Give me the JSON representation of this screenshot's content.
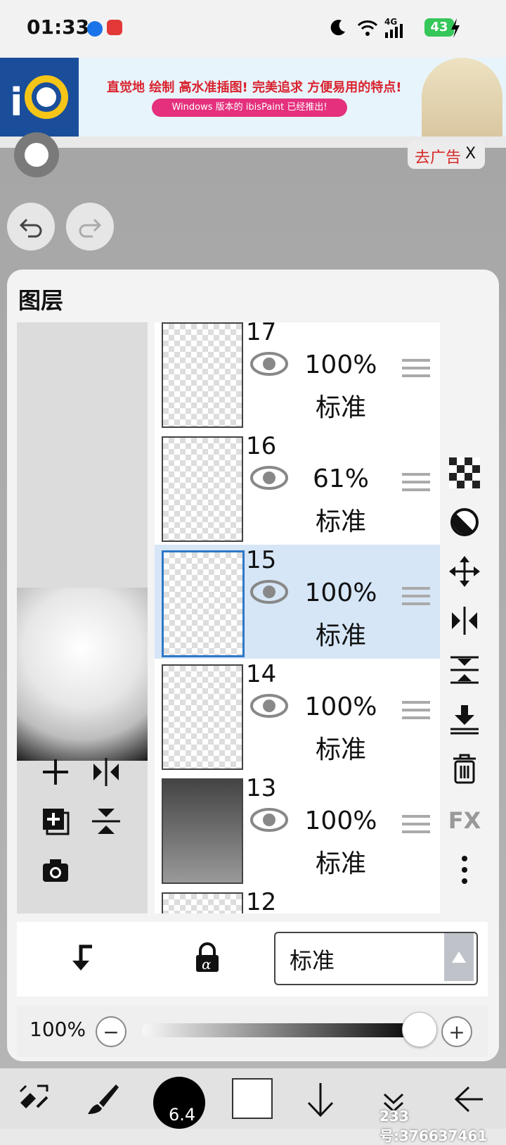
{
  "status_bar": {
    "time": "01:33",
    "network": "4G",
    "battery": "43"
  },
  "ad": {
    "headline": "直觉地 绘制 高水准插图! 完美追求 方便易用的特点!",
    "subline": "Windows 版本的 ibisPaint 已经推出!",
    "remove_ad": "去广告",
    "close": "X"
  },
  "panel": {
    "title": "图层"
  },
  "layers": [
    {
      "number": "17",
      "opacity": "100%",
      "mode": "标准"
    },
    {
      "number": "16",
      "opacity": "61%",
      "mode": "标准"
    },
    {
      "number": "15",
      "opacity": "100%",
      "mode": "标准"
    },
    {
      "number": "14",
      "opacity": "100%",
      "mode": "标准"
    },
    {
      "number": "13",
      "opacity": "100%",
      "mode": "标准"
    },
    {
      "number": "12",
      "opacity": "",
      "mode": ""
    }
  ],
  "right_tools": {
    "fx": "FX"
  },
  "blend": {
    "mode": "标准"
  },
  "opacity_control": {
    "value": "100%",
    "minus": "−",
    "plus": "+",
    "level": 1.0
  },
  "toolbar": {
    "brush_size": "6.4"
  },
  "watermark": "233号:37663746​1"
}
